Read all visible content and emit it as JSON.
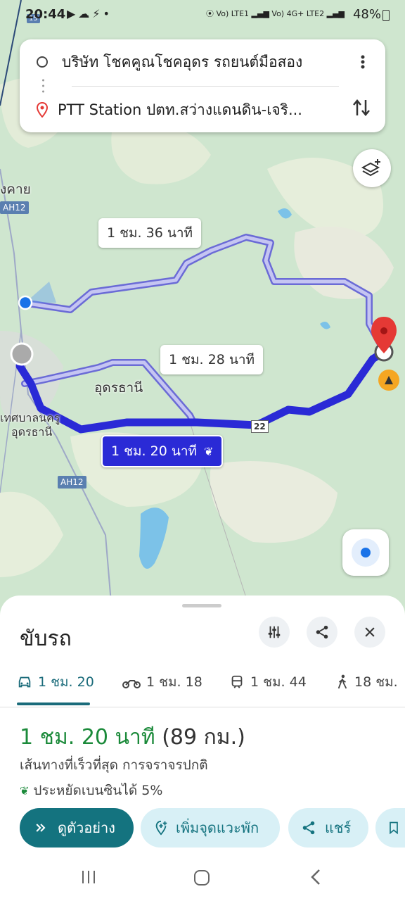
{
  "status_bar": {
    "time": "20:44",
    "battery": "48%",
    "network_1": "Vo) LTE1",
    "network_2": "Vo) 4G+ LTE2"
  },
  "directions": {
    "origin": "บริษัท โชคคูณโชคอุดร รถยนต์มือสอง",
    "destination": "PTT Station ปตท.สว่างแดนดิน-เจริ..."
  },
  "map": {
    "labels": {
      "town_left": "งคาย",
      "city": "อุดรธานี",
      "municipality_line1": "เทศบาลนครู",
      "municipality_line2": "อุดรธานี"
    },
    "road_shields": {
      "ah12_top": "AH12",
      "ah12_bottom": "AH12",
      "route22": "22",
      "top_left": "15"
    },
    "route_labels": {
      "alt1": "1 ชม. 36 นาที",
      "alt2": "1 ชม. 28 นาที",
      "selected": "1 ชม. 20 นาที"
    }
  },
  "sheet": {
    "title": "ขับรถ",
    "modes": [
      {
        "icon": "car-icon",
        "label": "1 ชม. 20",
        "active": true
      },
      {
        "icon": "motorcycle-icon",
        "label": "1 ชม. 18",
        "active": false
      },
      {
        "icon": "transit-icon",
        "label": "1 ชม. 44",
        "active": false
      },
      {
        "icon": "walk-icon",
        "label": "18 ชม.",
        "active": false
      }
    ],
    "summary_time": "1 ชม. 20 นาที",
    "summary_distance": "(89 กม.)",
    "route_desc": "เส้นทางที่เร็วที่สุด การจราจรปกติ",
    "fuel_saving": "ประหยัดเบนซินได้ 5%",
    "actions": {
      "preview": "ดูตัวอย่าง",
      "add_stop": "เพิ่มจุดแวะพัก",
      "share": "แชร์"
    }
  },
  "colors": {
    "route_selected": "#2a2ad6",
    "route_alt": "#9b9be0",
    "accent": "#14737f",
    "time_green": "#1b8a3a"
  }
}
